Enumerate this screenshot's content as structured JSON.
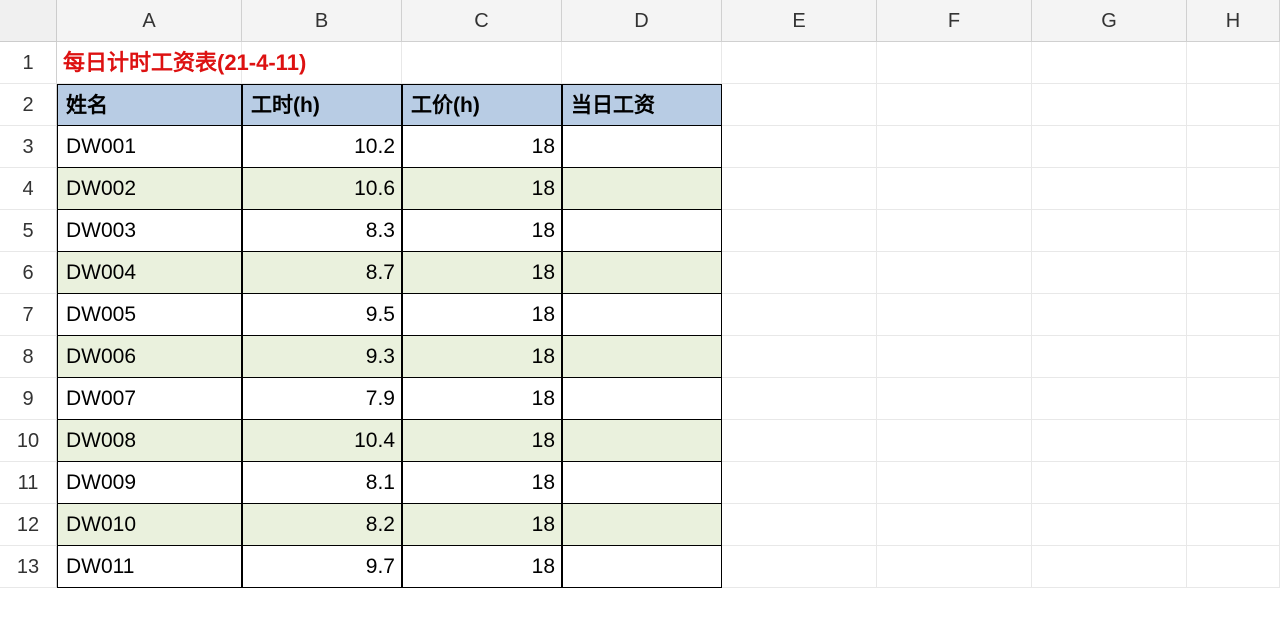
{
  "columns": [
    "A",
    "B",
    "C",
    "D",
    "E",
    "F",
    "G",
    "H"
  ],
  "rowNumbers": [
    "1",
    "2",
    "3",
    "4",
    "5",
    "6",
    "7",
    "8",
    "9",
    "10",
    "11",
    "12",
    "13"
  ],
  "title": "每日计时工资表(21-4-11)",
  "headers": [
    "姓名",
    "工时(h)",
    "工价(h)",
    "当日工资"
  ],
  "rows": [
    {
      "name": "DW001",
      "hours": "10.2",
      "rate": "18",
      "wage": ""
    },
    {
      "name": "DW002",
      "hours": "10.6",
      "rate": "18",
      "wage": ""
    },
    {
      "name": "DW003",
      "hours": "8.3",
      "rate": "18",
      "wage": ""
    },
    {
      "name": "DW004",
      "hours": "8.7",
      "rate": "18",
      "wage": ""
    },
    {
      "name": "DW005",
      "hours": "9.5",
      "rate": "18",
      "wage": ""
    },
    {
      "name": "DW006",
      "hours": "9.3",
      "rate": "18",
      "wage": ""
    },
    {
      "name": "DW007",
      "hours": "7.9",
      "rate": "18",
      "wage": ""
    },
    {
      "name": "DW008",
      "hours": "10.4",
      "rate": "18",
      "wage": ""
    },
    {
      "name": "DW009",
      "hours": "8.1",
      "rate": "18",
      "wage": ""
    },
    {
      "name": "DW010",
      "hours": "8.2",
      "rate": "18",
      "wage": ""
    },
    {
      "name": "DW011",
      "hours": "9.7",
      "rate": "18",
      "wage": ""
    }
  ]
}
